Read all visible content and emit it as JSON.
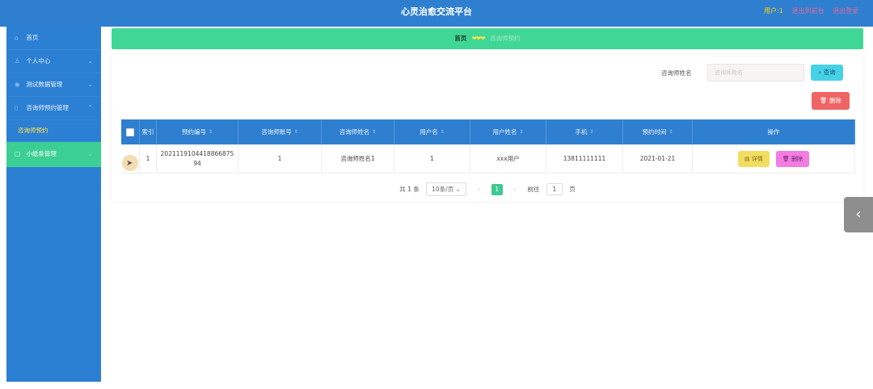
{
  "header": {
    "app_title": "心灵治愈交流平台",
    "user": "用户:1",
    "exit_front": "退出到前台",
    "logout": "退出登录"
  },
  "sidebar": {
    "items": [
      {
        "label": "首页",
        "icon": "home-icon"
      },
      {
        "label": "个人中心",
        "icon": "user-icon"
      },
      {
        "label": "测试数据管理",
        "icon": "data-icon"
      },
      {
        "label": "咨询师预约管理",
        "icon": "calendar-icon"
      },
      {
        "label": "咨询师预约",
        "icon": ""
      },
      {
        "label": "小纸条管理",
        "icon": "note-icon"
      }
    ]
  },
  "breadcrumb": {
    "home": "首页",
    "separator": "❤❤❤",
    "current": "咨询师预约"
  },
  "search": {
    "label": "咨询师姓名",
    "placeholder": "咨询师姓名",
    "button": "查询",
    "delete_button": "删除"
  },
  "table": {
    "headers": [
      "索引",
      "预约编号",
      "咨询师账号",
      "咨询师姓名",
      "用户名",
      "用户姓名",
      "手机",
      "预约时间",
      "操作"
    ],
    "rows": [
      {
        "index": "1",
        "order_no": "2021119104418866875 94",
        "counselor_account": "1",
        "counselor_name": "咨询师姓名1",
        "username": "1",
        "user_fullname": "xxx用户",
        "phone": "13811111111",
        "time": "2021-01-21",
        "detail": "详情",
        "delete": "删除"
      }
    ]
  },
  "pagination": {
    "total": "共 1 条",
    "page_size": "10条/页",
    "current_page": "1",
    "goto_prefix": "前往",
    "goto_value": "1",
    "goto_suffix": "页"
  },
  "colors": {
    "topbar": "#2f7fd1",
    "sidebar": "#2b80d4",
    "accent_green": "#40d796",
    "search_btn": "#46d2e6",
    "delete_btn": "#ef6464",
    "detail_btn": "#f3dd61",
    "row_delete_btn": "#f27ce0"
  }
}
